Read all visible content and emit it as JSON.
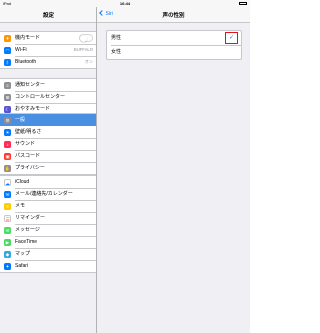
{
  "status_bar": {
    "carrier": "iPad",
    "time": "16:44"
  },
  "master": {
    "title": "設定",
    "groups": [
      {
        "items": [
          {
            "label": "機内モード",
            "icon": "airplane-icon",
            "icon_color": "#ff9500",
            "glyph": "✈",
            "toggle": "off"
          },
          {
            "label": "Wi-Fi",
            "icon": "wifi-icon",
            "icon_color": "#007aff",
            "glyph": "◠",
            "value": "BUFFALO"
          },
          {
            "label": "Bluetooth",
            "icon": "bluetooth-icon",
            "icon_color": "#007aff",
            "glyph": "ᛒ",
            "value": "オン"
          }
        ]
      },
      {
        "items": [
          {
            "label": "通知センター",
            "icon": "notification-center-icon",
            "icon_color": "#8e8e93",
            "glyph": "≡"
          },
          {
            "label": "コントロールセンター",
            "icon": "control-center-icon",
            "icon_color": "#8e8e93",
            "glyph": "⊞"
          },
          {
            "label": "おやすみモード",
            "icon": "moon-icon",
            "icon_color": "#5856d6",
            "glyph": "☾"
          }
        ]
      },
      {
        "items": [
          {
            "label": "一般",
            "icon": "gear-icon",
            "icon_color": "#8e8e93",
            "glyph": "⚙",
            "selected": true
          },
          {
            "label": "壁紙/明るさ",
            "icon": "brightness-icon",
            "icon_color": "#007aff",
            "glyph": "☀"
          },
          {
            "label": "サウンド",
            "icon": "sound-icon",
            "icon_color": "#ff2d55",
            "glyph": "♪"
          },
          {
            "label": "パスコード",
            "icon": "passcode-lock-icon",
            "icon_color": "#ff3b30",
            "glyph": "▣"
          },
          {
            "label": "プライバシー",
            "icon": "privacy-hand-icon",
            "icon_color": "#8e8e93",
            "glyph": "✋"
          }
        ]
      },
      {
        "items": [
          {
            "label": "iCloud",
            "icon": "icloud-icon",
            "icon_color": "#ffffff",
            "glyph": "☁",
            "glyph_color": "#007aff"
          },
          {
            "label": "メール/連絡先/カレンダー",
            "icon": "mail-icon",
            "icon_color": "#007aff",
            "glyph": "✉"
          },
          {
            "label": "メモ",
            "icon": "notes-icon",
            "icon_color": "#ffcc00",
            "glyph": "≡"
          },
          {
            "label": "リマインダー",
            "icon": "reminders-icon",
            "icon_color": "#ffffff",
            "glyph": "☰",
            "glyph_color": "#ff3b30"
          },
          {
            "label": "メッセージ",
            "icon": "messages-icon",
            "icon_color": "#4cd964",
            "glyph": "✉"
          },
          {
            "label": "FaceTime",
            "icon": "facetime-icon",
            "icon_color": "#4cd964",
            "glyph": "▶"
          },
          {
            "label": "マップ",
            "icon": "maps-icon",
            "icon_color": "#34aadc",
            "glyph": "◆"
          },
          {
            "label": "Safari",
            "icon": "safari-compass-icon",
            "icon_color": "#007aff",
            "glyph": "✦"
          }
        ]
      }
    ]
  },
  "detail": {
    "back_label": "Siri",
    "title": "声の性別",
    "options": [
      {
        "label": "男性",
        "checked": true
      },
      {
        "label": "女性",
        "checked": false
      }
    ],
    "checkmark": "✓"
  }
}
